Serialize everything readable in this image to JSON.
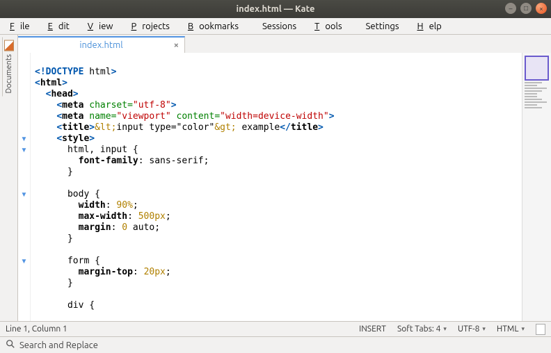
{
  "window": {
    "title": "index.html — Kate"
  },
  "menu": {
    "file": "File",
    "edit": "Edit",
    "view": "View",
    "projects": "Projects",
    "bookmarks": "Bookmarks",
    "sessions": "Sessions",
    "tools": "Tools",
    "settings": "Settings",
    "help": "Help"
  },
  "side": {
    "documents": "Documents"
  },
  "tab": {
    "name": "index.html"
  },
  "code_lines": [
    {
      "raw": ""
    },
    {
      "raw": "<angle><!</angle><doctype>DOCTYPE</doctype> html<angle>></angle>"
    },
    {
      "raw": "<angle><</angle><kw>html</kw><angle>></angle>"
    },
    {
      "raw": "  <angle><</angle><kw>head</kw><angle>></angle>"
    },
    {
      "raw": "    <angle><</angle><kw>meta</kw> <attr>charset=</attr><str>\"utf-8\"</str><angle>></angle>"
    },
    {
      "raw": "    <angle><</angle><kw>meta</kw> <attr>name=</attr><str>\"viewport\"</str> <attr>content=</attr><str>\"width=device-width\"</str><angle>></angle>"
    },
    {
      "raw": "    <angle><</angle><kw>title</kw><angle>></angle><entity>&amp;lt;</entity>input type=\"color\"<entity>&amp;gt;</entity> example<angle></</angle><kw>title</kw><angle>></angle>"
    },
    {
      "raw": "    <angle><</angle><kw>style</kw><angle>></angle>",
      "fold": true
    },
    {
      "raw": "      html, input {",
      "fold": true
    },
    {
      "raw": "        <prop>font-family</prop>: sans-serif;"
    },
    {
      "raw": "      }"
    },
    {
      "raw": ""
    },
    {
      "raw": "      body {",
      "fold": true
    },
    {
      "raw": "        <prop>width</prop>: <val>90%</val>;"
    },
    {
      "raw": "        <prop>max-width</prop>: <val>500px</val>;"
    },
    {
      "raw": "        <prop>margin</prop>: <val>0</val> auto;"
    },
    {
      "raw": "      }"
    },
    {
      "raw": ""
    },
    {
      "raw": "      form {",
      "fold": true
    },
    {
      "raw": "        <prop>margin-top</prop>: <val>20px</val>;"
    },
    {
      "raw": "      }"
    },
    {
      "raw": ""
    },
    {
      "raw": "      div {"
    }
  ],
  "status": {
    "position": "Line 1, Column 1",
    "mode": "INSERT",
    "tabs": "Soft Tabs: 4",
    "encoding": "UTF-8",
    "filetype": "HTML"
  },
  "search": {
    "label": "Search and Replace"
  }
}
